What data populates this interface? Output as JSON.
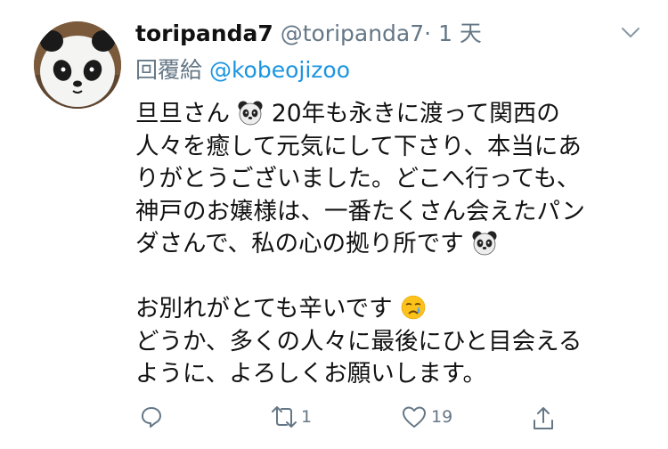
{
  "tweet": {
    "display_name": "toripanda7",
    "handle": "@toripanda7",
    "separator": "·",
    "time": "1 天",
    "reply_prefix": "回覆給",
    "reply_to": "@kobeojizoo",
    "lines": [
      "旦旦さん",
      "20年も永きに渡って関西の",
      "人々を癒して元気にして下さり、本当にあ",
      "りがとうございました。どこへ行っても、",
      "神戸のお嬢様は、一番たくさん会えたパン",
      "ダさんで、私の心の拠り所です",
      "お別れがとても辛いです",
      "どうか、多くの人々に最後にひと目会える",
      "ように、よろしくお願いします。"
    ],
    "emojis": [
      "panda-face",
      "panda-face",
      "crying-face"
    ]
  },
  "actions": {
    "retweets": "1",
    "likes": "19"
  },
  "colors": {
    "text": "#111111",
    "secondary": "#657786",
    "link": "#1b95e0"
  }
}
